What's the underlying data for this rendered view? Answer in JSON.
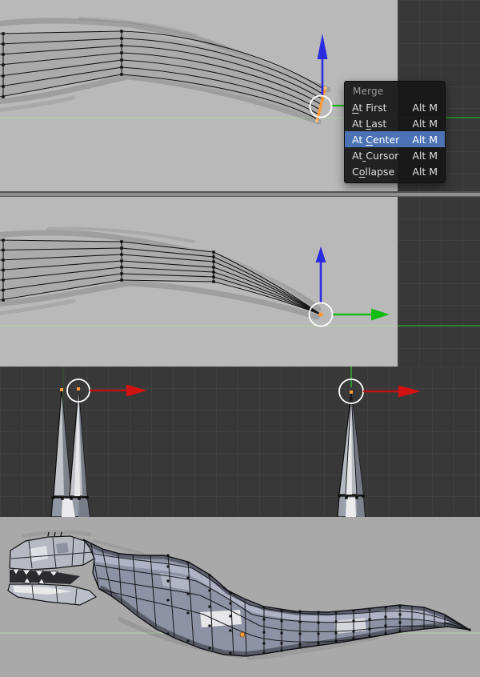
{
  "merge_menu": {
    "title": "Merge",
    "items": [
      {
        "pre": "",
        "ul": "A",
        "post": "t First",
        "shortcut": "Alt M",
        "highlighted": false
      },
      {
        "pre": "At ",
        "ul": "L",
        "post": "ast",
        "shortcut": "Alt M",
        "highlighted": false
      },
      {
        "pre": "At ",
        "ul": "C",
        "post": "enter",
        "shortcut": "Alt M",
        "highlighted": true
      },
      {
        "pre": "At",
        "ul": " ",
        "post": "Cursor",
        "shortcut": "Alt M",
        "highlighted": false
      },
      {
        "pre": "C",
        "ul": "o",
        "post": "llapse",
        "shortcut": "Alt M",
        "highlighted": false
      }
    ]
  },
  "icons": {
    "z_axis_arrow": "blue up-arrow manipulator",
    "y_axis_arrow": "green right-arrow manipulator",
    "x_axis_arrow": "red right-arrow manipulator",
    "selection_circle": "white circle annotation",
    "selected_vertex_dot": "orange vertex dot",
    "selected_edge": "orange highlighted edge"
  },
  "colors": {
    "axis_x": "#cf1212",
    "axis_y": "#13bd13",
    "axis_z": "#2b2be0",
    "selected_element": "#ff9a3c",
    "menu_highlight": "#4a72b5",
    "menu_bg": "#171717",
    "viewport_light_bg": "#b9b9b9",
    "viewport_dark_bg": "#383838",
    "model_viewport_bg": "#a9a9a9",
    "floor_line_on_light": "#b5c9ae",
    "floor_line_on_dark": "#259825",
    "annotation_circle": "#ffffff"
  }
}
